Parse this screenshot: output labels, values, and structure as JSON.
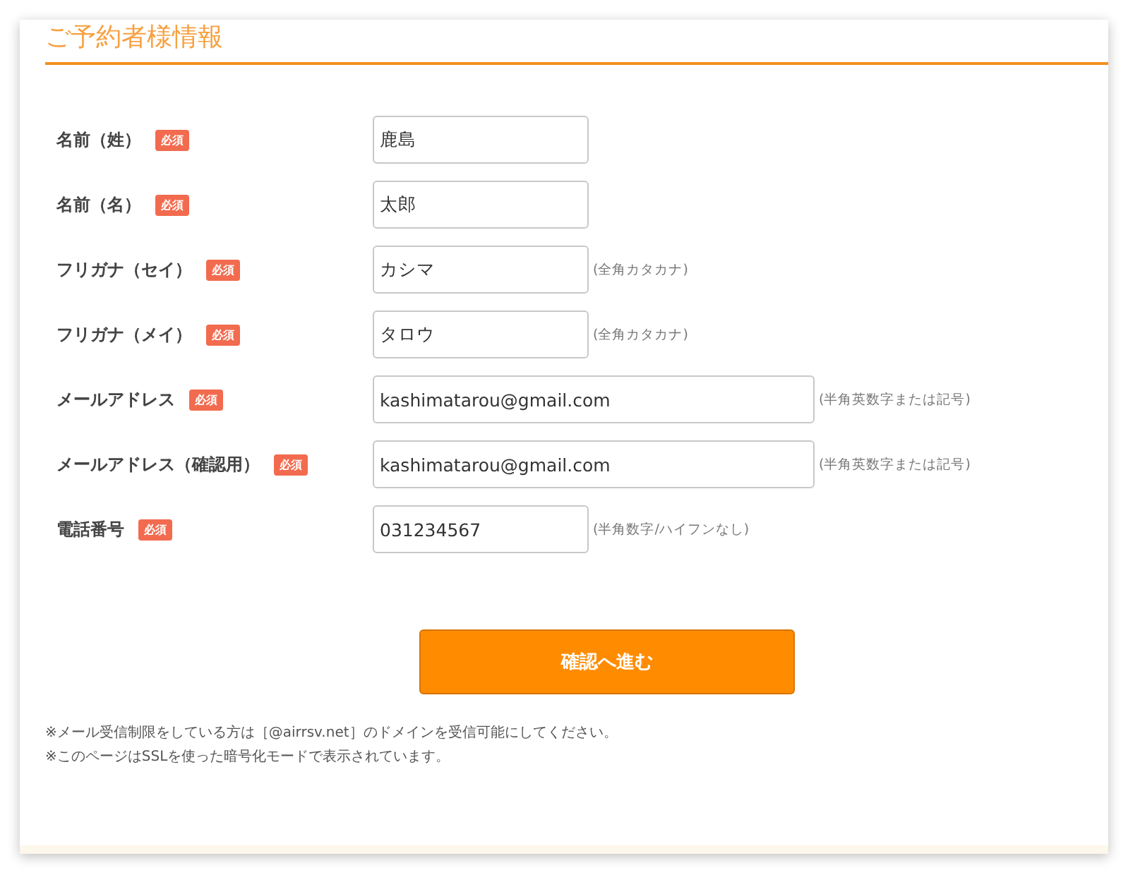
{
  "heading": "ご予約者様情報",
  "fields": [
    {
      "label": "名前（姓）",
      "required": true,
      "badge": "必須",
      "value": "鹿島",
      "kind": "short"
    },
    {
      "label": "名前（名）",
      "required": true,
      "badge": "必須",
      "value": "太郎",
      "kind": "short"
    },
    {
      "label": "フリガナ（セイ）",
      "required": true,
      "badge": "必須",
      "value": "カシマ",
      "kind": "short",
      "hint": "(全角カタカナ)"
    },
    {
      "label": "フリガナ（メイ）",
      "required": true,
      "badge": "必須",
      "value": "タロウ",
      "kind": "short",
      "hint": "(全角カタカナ)"
    },
    {
      "label": "メールアドレス",
      "required": true,
      "badge": "必須",
      "value": "kashimatarou@gmail.com",
      "kind": "long",
      "hint": "(半角英数字または記号)"
    },
    {
      "label": "メールアドレス（確認用）",
      "required": true,
      "badge": "必須",
      "value": "kashimatarou@gmail.com",
      "kind": "long",
      "hint": "(半角英数字または記号)"
    },
    {
      "label": "電話番号",
      "required": true,
      "badge": "必須",
      "value": "031234567",
      "kind": "short",
      "hint": "(半角数字/ハイフンなし)"
    }
  ],
  "submit_button": "確認へ進む",
  "notes": [
    "※メール受信制限をしている方は［@airrsv.net］のドメインを受信可能にしてください。",
    "※このページはSSLを使った暗号化モードで表示されています。"
  ]
}
